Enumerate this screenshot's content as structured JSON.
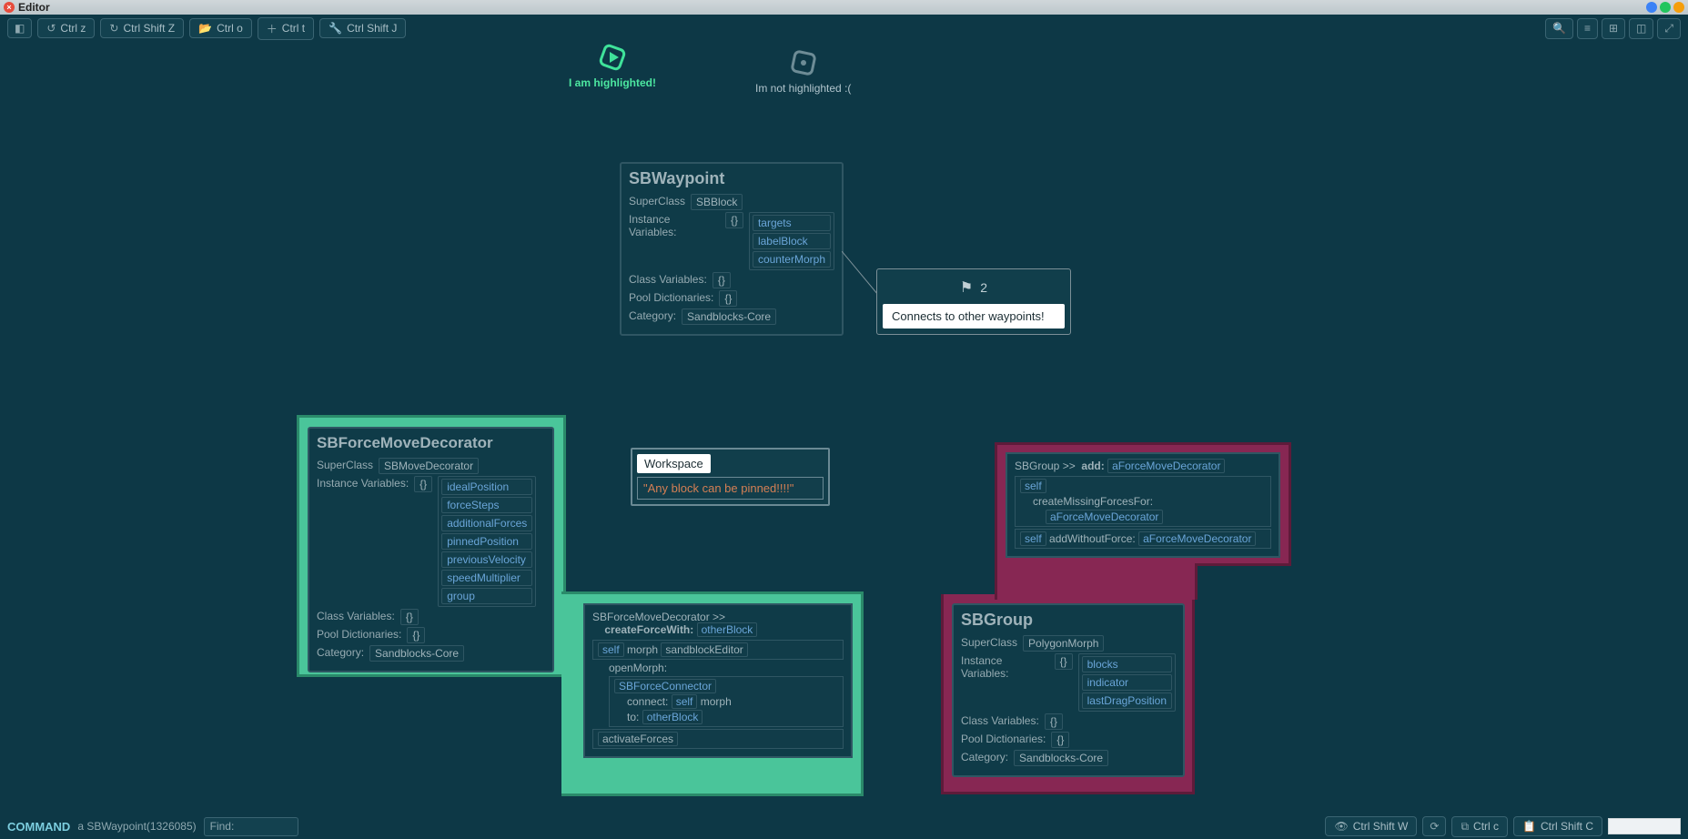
{
  "title": "Editor",
  "toolbar": {
    "undo": "Ctrl z",
    "redo": "Ctrl Shift Z",
    "open": "Ctrl o",
    "new": "Ctrl t",
    "inspect": "Ctrl Shift J"
  },
  "shapes": {
    "highlighted_label": "I am highlighted!",
    "not_highlighted_label": "Im not highlighted :("
  },
  "waypoint_block": {
    "title": "SBWaypoint",
    "superclass_label": "SuperClass",
    "superclass": "SBBlock",
    "instance_vars_label": "Instance Variables:",
    "instance_vars": [
      "targets",
      "labelBlock",
      "counterMorph"
    ],
    "class_vars_label": "Class Variables:",
    "pool_dict_label": "Pool Dictionaries:",
    "category_label": "Category:",
    "category": "Sandblocks-Core"
  },
  "waypoint_node": {
    "count": "2",
    "body": "Connects to other waypoints!"
  },
  "decorator_block": {
    "title": "SBForceMoveDecorator",
    "superclass_label": "SuperClass",
    "superclass": "SBMoveDecorator",
    "instance_vars_label": "Instance Variables:",
    "instance_vars": [
      "idealPosition",
      "forceSteps",
      "additionalForces",
      "pinnedPosition",
      "previousVelocity",
      "speedMultiplier",
      "group"
    ],
    "class_vars_label": "Class Variables:",
    "pool_dict_label": "Pool Dictionaries:",
    "category_label": "Category:",
    "category": "Sandblocks-Core"
  },
  "workspace": {
    "title": "Workspace",
    "body": "\"Any block can be pinned!!!!\""
  },
  "method_create": {
    "class": "SBForceMoveDecorator >>",
    "selector": "createForceWith:",
    "arg": "otherBlock",
    "self": "self",
    "morph": "morph",
    "sandblockEditor": "sandblockEditor",
    "openMorph": "openMorph:",
    "connector": "SBForceConnector",
    "connect": "connect:",
    "to": "to:",
    "activateForces": "activateForces"
  },
  "method_add": {
    "class": "SBGroup >>",
    "selector": "add:",
    "arg": "aForceMoveDecorator",
    "self": "self",
    "createMissing": "createMissingForcesFor:",
    "addWithoutForce": "addWithoutForce:"
  },
  "group_block": {
    "title": "SBGroup",
    "superclass_label": "SuperClass",
    "superclass": "PolygonMorph",
    "instance_vars_label": "Instance Variables:",
    "instance_vars": [
      "blocks",
      "indicator",
      "lastDragPosition"
    ],
    "class_vars_label": "Class Variables:",
    "pool_dict_label": "Pool Dictionaries:",
    "category_label": "Category:",
    "category": "Sandblocks-Core"
  },
  "command_bar": {
    "mode": "COMMAND",
    "info": "a SBWaypoint(1326085)",
    "find": "Find:"
  },
  "bottom_buttons": {
    "watch": "Ctrl Shift W",
    "copy": "Ctrl c",
    "copy_string": "Ctrl Shift C"
  }
}
